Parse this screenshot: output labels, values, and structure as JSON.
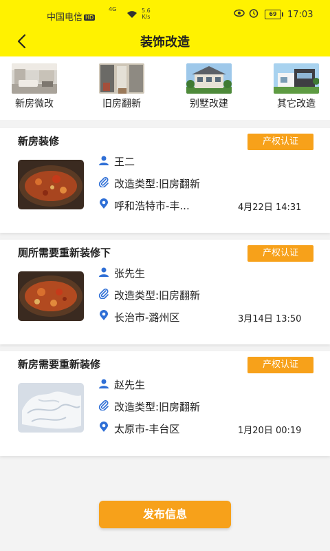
{
  "status_bar": {
    "carrier": "中国电信",
    "hd": "HD",
    "network": "4G",
    "speed_value": "5.6",
    "speed_unit": "K/s",
    "battery": "69",
    "time": "17:03"
  },
  "header": {
    "back_icon": "chevron-left-icon",
    "title": "装饰改造"
  },
  "categories": [
    {
      "label": "新房微改"
    },
    {
      "label": "旧房翻新"
    },
    {
      "label": "别墅改建"
    },
    {
      "label": "其它改造"
    }
  ],
  "posts": [
    {
      "title": "新房装修",
      "badge": "产权认证",
      "name": "王二",
      "type": "改造类型:旧房翻新",
      "location": "呼和浩特市-丰...",
      "date": "4月22日 14:31"
    },
    {
      "title": "厕所需要重新装修下",
      "badge": "产权认证",
      "name": "张先生",
      "type": "改造类型:旧房翻新",
      "location": "长治市-潞州区",
      "date": "3月14日 13:50"
    },
    {
      "title": "新房需要重新装修",
      "badge": "产权认证",
      "name": "赵先生",
      "type": "改造类型:旧房翻新",
      "location": "太原市-丰台区",
      "date": "1月20日 00:19"
    }
  ],
  "publish_button": "发布信息",
  "colors": {
    "header_bg": "#fff200",
    "accent": "#f7a11a",
    "icon_blue": "#2f6fd6"
  }
}
